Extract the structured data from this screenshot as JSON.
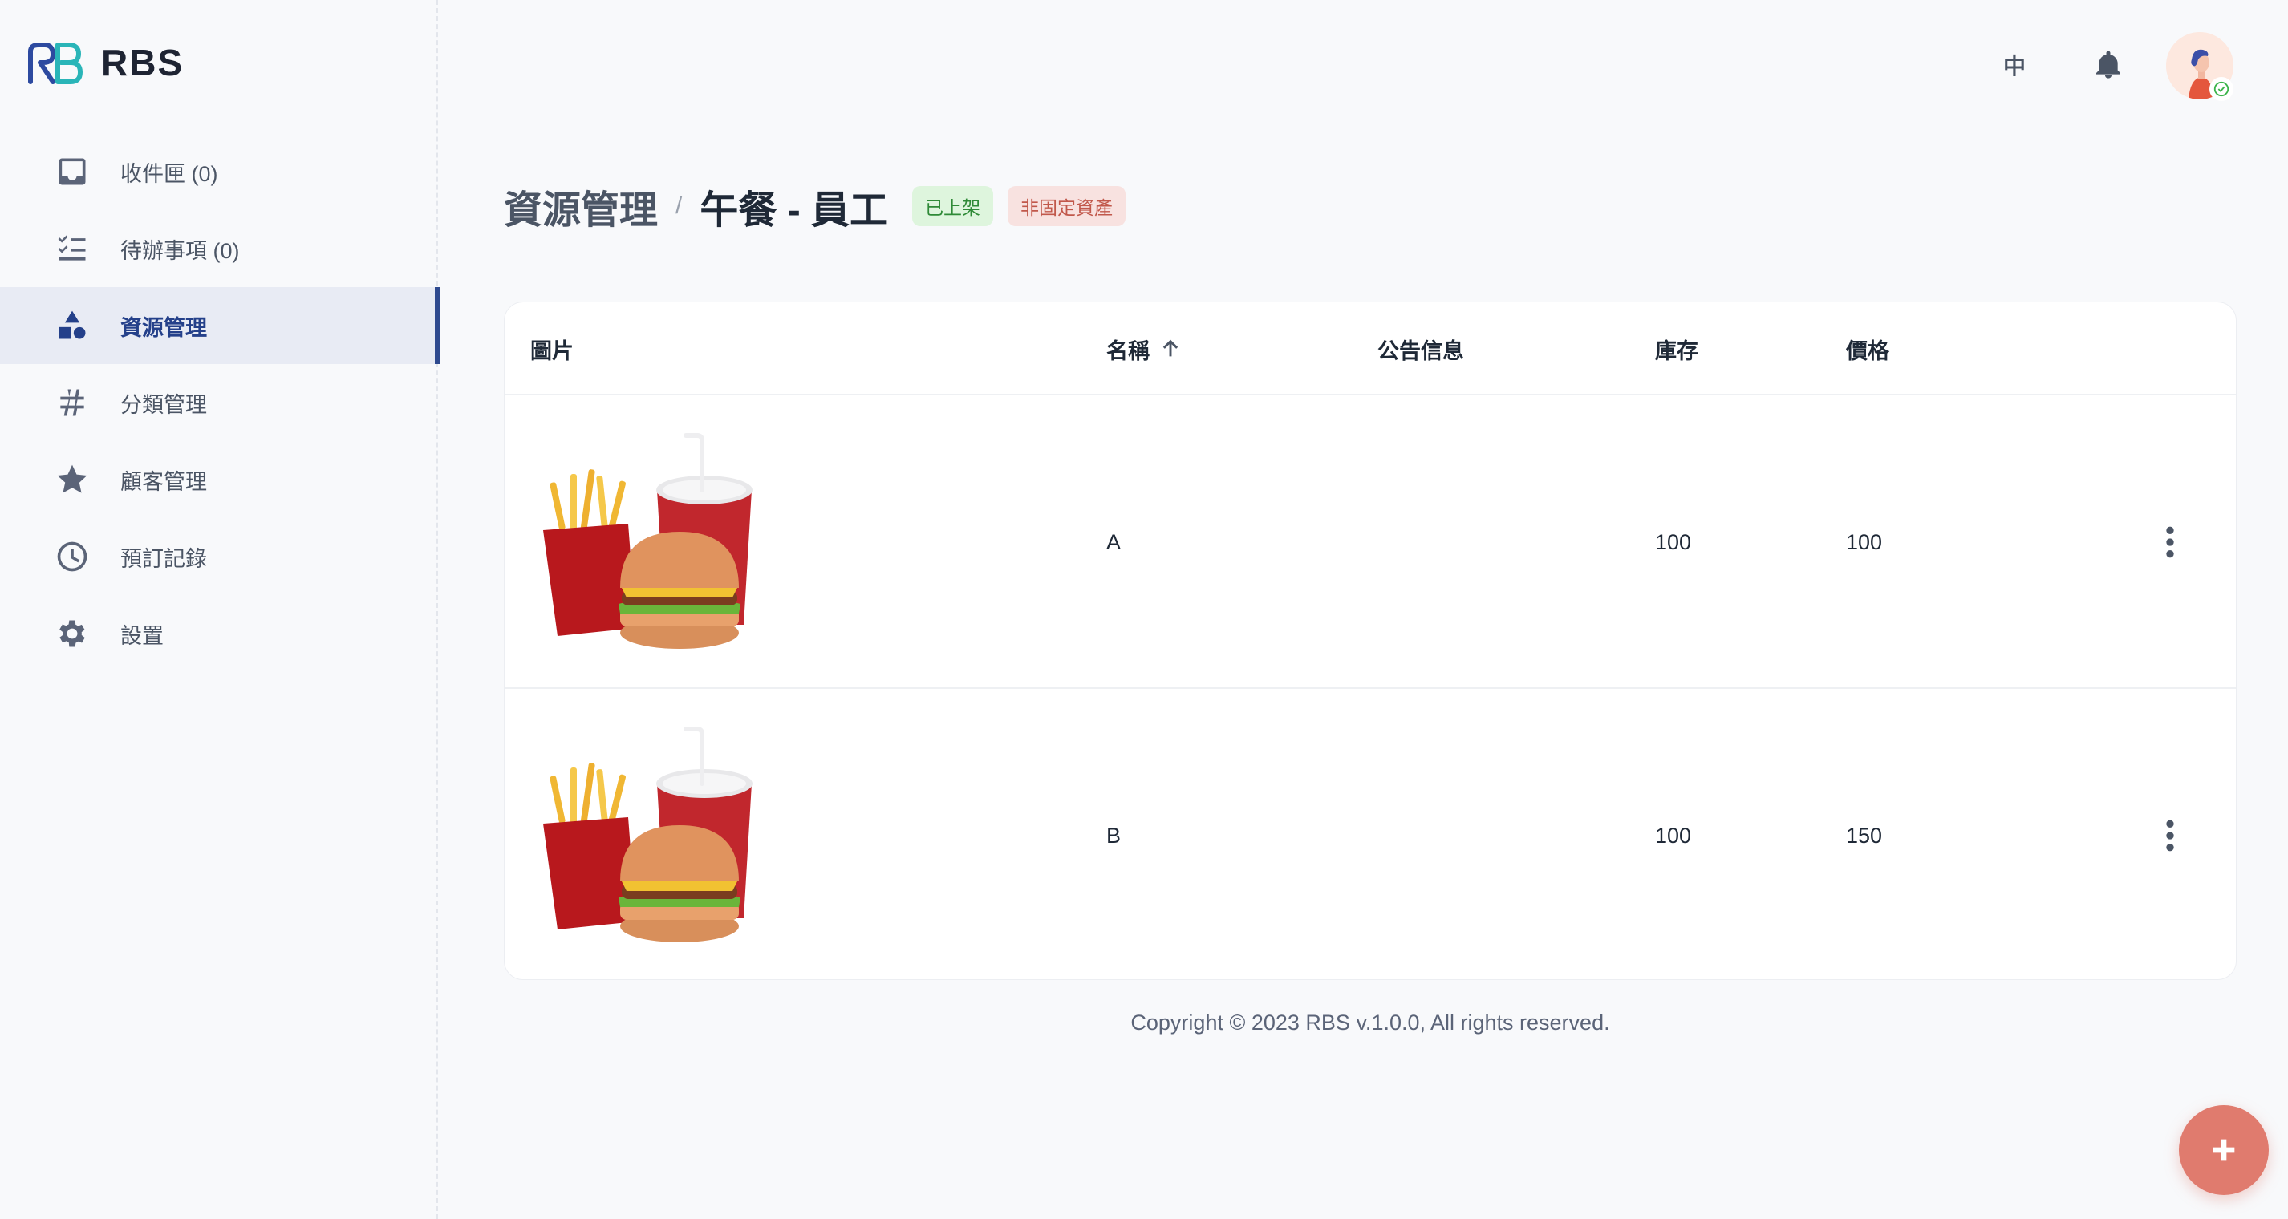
{
  "app": {
    "name": "RBS"
  },
  "sidebar": {
    "items": [
      {
        "label": "收件匣 (0)",
        "icon": "inbox-icon"
      },
      {
        "label": "待辦事項 (0)",
        "icon": "checklist-icon"
      },
      {
        "label": "資源管理",
        "icon": "shapes-icon",
        "active": true
      },
      {
        "label": "分類管理",
        "icon": "hash-icon"
      },
      {
        "label": "顧客管理",
        "icon": "star-icon"
      },
      {
        "label": "預訂記錄",
        "icon": "clock-icon"
      },
      {
        "label": "設置",
        "icon": "gear-icon"
      }
    ]
  },
  "topbar": {
    "language": "中"
  },
  "header": {
    "breadcrumb_root": "資源管理",
    "separator": "/",
    "title": "午餐 - 員工",
    "badges": [
      {
        "label": "已上架",
        "color": "#2f8a37"
      },
      {
        "label": "非固定資產",
        "color": "#c1584b"
      }
    ]
  },
  "table": {
    "columns": [
      "圖片",
      "名稱",
      "公告信息",
      "庫存",
      "價格"
    ],
    "sorted_column": "名稱",
    "sort_direction": "ascending",
    "rows": [
      {
        "name": "A",
        "notice": "",
        "stock": "100",
        "price": "100"
      },
      {
        "name": "B",
        "notice": "",
        "stock": "100",
        "price": "150"
      }
    ]
  },
  "footer": {
    "copyright": "Copyright © 2023 RBS v.1.0.0, All rights reserved."
  },
  "colors": {
    "accent": "#24408a",
    "fab": "#e07b6e"
  }
}
